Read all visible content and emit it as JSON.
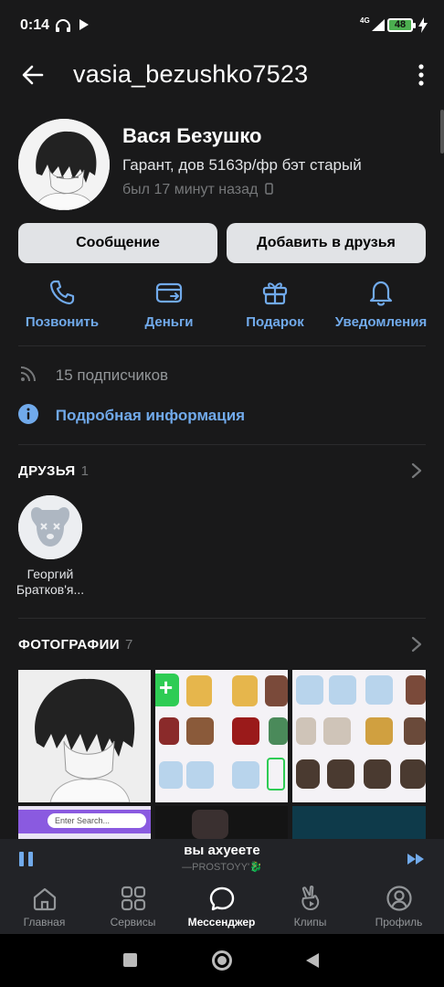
{
  "status_bar": {
    "time": "0:14",
    "battery": "48",
    "network": "4G"
  },
  "header": {
    "username": "vasia_bezushko7523"
  },
  "profile": {
    "name": "Вася Безушко",
    "status": "Гарант, дов 5163р/фр бэт старый",
    "last_seen": "был 17 минут назад"
  },
  "buttons": {
    "message": "Сообщение",
    "add_friend": "Добавить в друзья"
  },
  "actions": [
    {
      "label": "Позвонить",
      "icon": "phone-icon"
    },
    {
      "label": "Деньги",
      "icon": "money-icon"
    },
    {
      "label": "Подарок",
      "icon": "gift-icon"
    },
    {
      "label": "Уведомления",
      "icon": "bell-icon"
    }
  ],
  "info": {
    "followers": "15 подписчиков",
    "details": "Подробная информация"
  },
  "friends": {
    "title": "ДРУЗЬЯ",
    "count": "1",
    "items": [
      {
        "name": "Георгий Братков'я..."
      }
    ]
  },
  "photos": {
    "title": "ФОТОГРАФИИ",
    "count": "7",
    "search_placeholder": "Enter Search..."
  },
  "player": {
    "title": "вы ахуеете",
    "artist": "—PROSTOYY'🐉"
  },
  "tabs": [
    {
      "label": "Главная",
      "icon": "home-icon"
    },
    {
      "label": "Сервисы",
      "icon": "services-icon"
    },
    {
      "label": "Мессенджер",
      "icon": "messenger-icon"
    },
    {
      "label": "Клипы",
      "icon": "clips-icon"
    },
    {
      "label": "Профиль",
      "icon": "profile-icon"
    }
  ],
  "colors": {
    "background": "#19191a",
    "accent": "#71aaeb",
    "button": "#e1e3e6",
    "secondary_text": "#76787a",
    "bar": "#222327"
  }
}
